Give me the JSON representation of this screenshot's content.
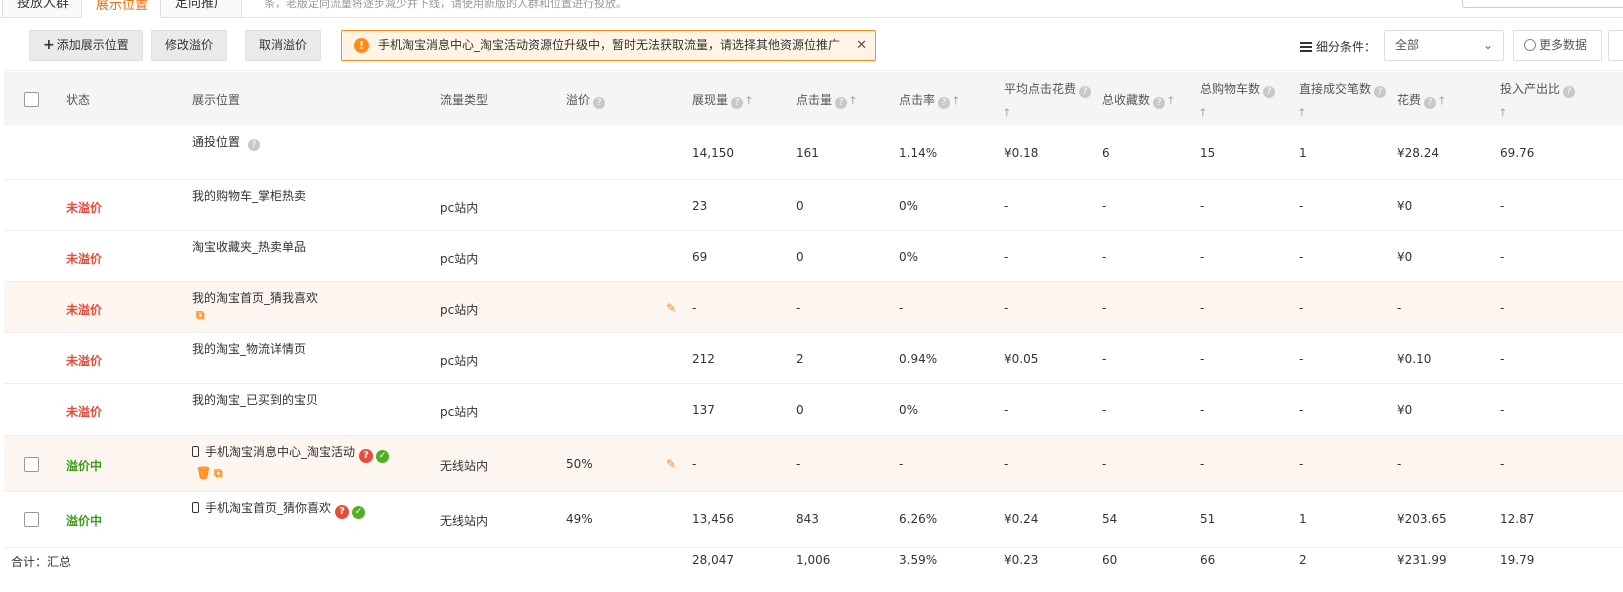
{
  "tabs": [
    "投放人群",
    "展示位置",
    "定向推广"
  ],
  "top_hint": "条，老版定向流量将逐步减少并下线，请使用新版的人群和位置进行投放。",
  "toolbar": {
    "add_label": "添加展示位置",
    "modify_label": "修改溢价",
    "cancel_label": "取消溢价",
    "warning": "手机淘宝消息中心_淘宝活动资源位升级中，暂时无法获取流量，请选择其他资源位推广",
    "segment_label": "细分条件：",
    "segment_value": "全部",
    "more_label": "更多数据"
  },
  "columns": {
    "status": "状态",
    "position": "展示位置",
    "traffic": "流量类型",
    "premium": "溢价",
    "impressions": "展现量",
    "clicks": "点击量",
    "ctr": "点击率",
    "avg_cpc": "平均点击花费",
    "favorites": "总收藏数",
    "cart": "总购物车数",
    "direct_deals": "直接成交笔数",
    "cost": "花费",
    "roi": "投入产出比"
  },
  "rows": [
    {
      "status": "",
      "name": "通投位置",
      "traffic": "",
      "premium": "",
      "impressions": "14,150",
      "clicks": "161",
      "ctr": "1.14%",
      "cpc": "¥0.18",
      "fav": "6",
      "cart": "15",
      "deals": "1",
      "cost": "¥28.24",
      "roi": "69.76"
    },
    {
      "status": "未溢价",
      "name": "我的购物车_掌柜热卖",
      "traffic": "pc站内",
      "premium": "",
      "impressions": "23",
      "clicks": "0",
      "ctr": "0%",
      "cpc": "-",
      "fav": "-",
      "cart": "-",
      "deals": "-",
      "cost": "¥0",
      "roi": "-"
    },
    {
      "status": "未溢价",
      "name": "淘宝收藏夹_热卖单品",
      "traffic": "pc站内",
      "premium": "",
      "impressions": "69",
      "clicks": "0",
      "ctr": "0%",
      "cpc": "-",
      "fav": "-",
      "cart": "-",
      "deals": "-",
      "cost": "¥0",
      "roi": "-"
    },
    {
      "status": "未溢价",
      "name": "我的淘宝首页_猜我喜欢",
      "traffic": "pc站内",
      "premium": "",
      "impressions": "-",
      "clicks": "-",
      "ctr": "-",
      "cpc": "-",
      "fav": "-",
      "cart": "-",
      "deals": "-",
      "cost": "-",
      "roi": "-"
    },
    {
      "status": "未溢价",
      "name": "我的淘宝_物流详情页",
      "traffic": "pc站内",
      "premium": "",
      "impressions": "212",
      "clicks": "2",
      "ctr": "0.94%",
      "cpc": "¥0.05",
      "fav": "-",
      "cart": "-",
      "deals": "-",
      "cost": "¥0.10",
      "roi": "-"
    },
    {
      "status": "未溢价",
      "name": "我的淘宝_已买到的宝贝",
      "traffic": "pc站内",
      "premium": "",
      "impressions": "137",
      "clicks": "0",
      "ctr": "0%",
      "cpc": "-",
      "fav": "-",
      "cart": "-",
      "deals": "-",
      "cost": "¥0",
      "roi": "-"
    },
    {
      "status": "溢价中",
      "name": "手机淘宝消息中心_淘宝活动",
      "traffic": "无线站内",
      "premium": "50%",
      "impressions": "-",
      "clicks": "-",
      "ctr": "-",
      "cpc": "-",
      "fav": "-",
      "cart": "-",
      "deals": "-",
      "cost": "-",
      "roi": "-"
    },
    {
      "status": "溢价中",
      "name": "手机淘宝首页_猜你喜欢",
      "traffic": "无线站内",
      "premium": "49%",
      "impressions": "13,456",
      "clicks": "843",
      "ctr": "6.26%",
      "cpc": "¥0.24",
      "fav": "54",
      "cart": "51",
      "deals": "1",
      "cost": "¥203.65",
      "roi": "12.87"
    }
  ],
  "summary": {
    "label": "合计：汇总",
    "impressions": "28,047",
    "clicks": "1,006",
    "ctr": "3.59%",
    "cpc": "¥0.23",
    "fav": "60",
    "cart": "66",
    "deals": "2",
    "cost": "¥231.99",
    "roi": "19.79"
  },
  "colors": {
    "accent": "#ff6a00",
    "status_red": "#e84c3d",
    "status_green": "#3d9a1e",
    "highlight_row": "#fdf5ef"
  }
}
